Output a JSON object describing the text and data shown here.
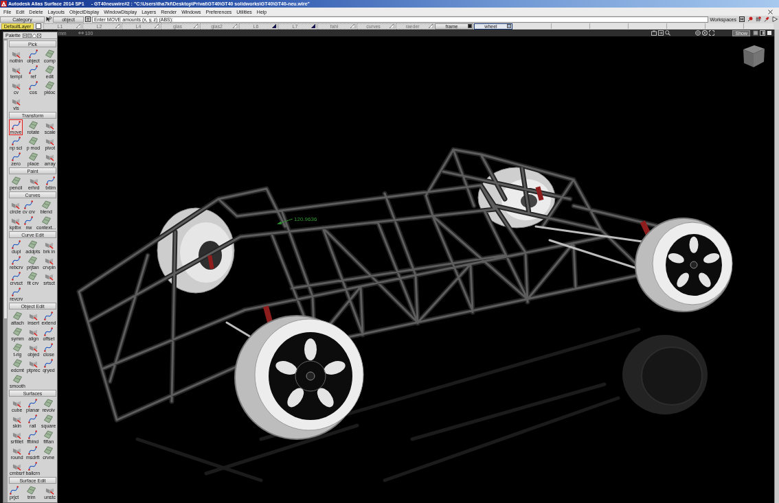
{
  "title_bar": {
    "app_name": "Autodesk Alias Surface 2014 SP1",
    "document": "- GT40neuwire#2 : \"C:\\Users\\tha7kf\\Desktop\\Privat\\GT40\\GT40 solidworks\\GT40\\GT40-neu.wire\""
  },
  "menu_bar": [
    "File",
    "Edit",
    "Delete",
    "Layouts",
    "ObjectDisplay",
    "WindowDisplay",
    "Layers",
    "Render",
    "Windows",
    "Preferences",
    "Utilities",
    "Help"
  ],
  "prompt_bar": {
    "category": "Category",
    "pick_mode": "object",
    "prompt": "Enter MOVE amounts (x, y, z) (ABS):",
    "workspaces": "Workspaces"
  },
  "layer_bar": {
    "default_layer": {
      "label": "DefaultLayer",
      "checked": false
    },
    "layers": [
      {
        "label": "L1",
        "visible": false,
        "marker_filled": false,
        "selected": false
      },
      {
        "label": "L2",
        "visible": false,
        "marker_filled": false,
        "selected": false
      },
      {
        "label": "L4",
        "visible": false,
        "marker_filled": false,
        "selected": false
      },
      {
        "label": "glas",
        "visible": false,
        "marker_filled": false,
        "selected": false
      },
      {
        "label": "glas2",
        "visible": false,
        "marker_filled": false,
        "selected": false
      },
      {
        "label": "L6",
        "visible": false,
        "marker_filled": true,
        "selected": false
      },
      {
        "label": "L7",
        "visible": false,
        "marker_filled": true,
        "selected": false
      },
      {
        "label": "fahl",
        "visible": false,
        "marker_filled": false,
        "selected": false
      },
      {
        "label": "curves",
        "visible": false,
        "marker_filled": false,
        "selected": false
      },
      {
        "label": "raeder",
        "visible": false,
        "marker_filled": false,
        "selected": false
      },
      {
        "label": "frame",
        "visible": true,
        "color": "#1a1a1a",
        "selected": false
      },
      {
        "label": "wheel",
        "visible": true,
        "color": "#a6b4cc",
        "selected": true
      }
    ]
  },
  "view_bar": {
    "units": "mm",
    "grid": "100",
    "show_button": "Show"
  },
  "palette": {
    "title": "Palette",
    "sections": [
      {
        "title": "Pick",
        "tools": [
          {
            "label": "nothin",
            "selected": false
          },
          {
            "label": "object",
            "selected": false
          },
          {
            "label": "comp",
            "selected": false
          },
          {
            "label": "templ",
            "selected": false
          },
          {
            "label": "ref",
            "selected": false
          },
          {
            "label": "edit",
            "selected": false
          },
          {
            "label": "cv",
            "selected": false
          },
          {
            "label": "cos",
            "selected": false
          },
          {
            "label": "pkloc",
            "selected": false
          },
          {
            "label": "vis",
            "selected": false
          }
        ]
      },
      {
        "title": "Transform",
        "tools": [
          {
            "label": "move",
            "selected": true
          },
          {
            "label": "rotate",
            "selected": false
          },
          {
            "label": "scale",
            "selected": false
          },
          {
            "label": "np scl",
            "selected": false
          },
          {
            "label": "p mod",
            "selected": false
          },
          {
            "label": "pivot",
            "selected": false
          },
          {
            "label": "zero",
            "selected": false
          },
          {
            "label": "place",
            "selected": false
          },
          {
            "label": "array",
            "selected": false
          }
        ]
      },
      {
        "title": "Paint",
        "tools": [
          {
            "label": "pencil",
            "selected": false
          },
          {
            "label": "erhrd",
            "selected": false
          },
          {
            "label": "txtim",
            "selected": false
          }
        ]
      },
      {
        "title": "Curves",
        "tools": [
          {
            "label": "circle",
            "selected": false
          },
          {
            "label": "cv crv",
            "selected": false
          },
          {
            "label": "blend",
            "selected": false
          },
          {
            "label": "kptbx",
            "selected": false
          },
          {
            "label": "nw",
            "selected": false
          },
          {
            "label": "context...",
            "selected": false
          }
        ]
      },
      {
        "title": "Curve Edit",
        "tools": [
          {
            "label": "dupl",
            "selected": false
          },
          {
            "label": "addpts",
            "selected": false
          },
          {
            "label": "brk in",
            "selected": false
          },
          {
            "label": "rebcrv",
            "selected": false
          },
          {
            "label": "prjtan",
            "selected": false
          },
          {
            "label": "crvpln",
            "selected": false
          },
          {
            "label": "crvsct",
            "selected": false
          },
          {
            "label": "fit crv",
            "selected": false
          },
          {
            "label": "srtsct",
            "selected": false
          },
          {
            "label": "revcrv",
            "selected": false
          }
        ]
      },
      {
        "title": "Object Edit",
        "tools": [
          {
            "label": "attach",
            "selected": false
          },
          {
            "label": "insert",
            "selected": false
          },
          {
            "label": "extend",
            "selected": false
          },
          {
            "label": "symm",
            "selected": false
          },
          {
            "label": "align",
            "selected": false
          },
          {
            "label": "offset",
            "selected": false
          },
          {
            "label": "t-rig",
            "selected": false
          },
          {
            "label": "objed",
            "selected": false
          },
          {
            "label": "close",
            "selected": false
          },
          {
            "label": "edcmt",
            "selected": false
          },
          {
            "label": "ptprec",
            "selected": false
          },
          {
            "label": "qryed",
            "selected": false
          },
          {
            "label": "smooth",
            "selected": false
          }
        ]
      },
      {
        "title": "Surfaces",
        "tools": [
          {
            "label": "cube",
            "selected": false
          },
          {
            "label": "planar",
            "selected": false
          },
          {
            "label": "revolv",
            "selected": false
          },
          {
            "label": "skin",
            "selected": false
          },
          {
            "label": "rail",
            "selected": false
          },
          {
            "label": "square",
            "selected": false
          },
          {
            "label": "srfillet",
            "selected": false
          },
          {
            "label": "ffblnd",
            "selected": false
          },
          {
            "label": "flflan",
            "selected": false
          },
          {
            "label": "round",
            "selected": false
          },
          {
            "label": "msdrft",
            "selected": false
          },
          {
            "label": "crvne",
            "selected": false
          },
          {
            "label": "crnbsrf",
            "selected": false
          },
          {
            "label": "ballcrn",
            "selected": false
          }
        ]
      },
      {
        "title": "Surface Edit",
        "tools": [
          {
            "label": "prjct",
            "selected": false
          },
          {
            "label": "trim",
            "selected": false
          },
          {
            "label": "unstc",
            "selected": false
          }
        ]
      }
    ]
  },
  "viewport": {
    "dimension_label": "120.9636"
  }
}
